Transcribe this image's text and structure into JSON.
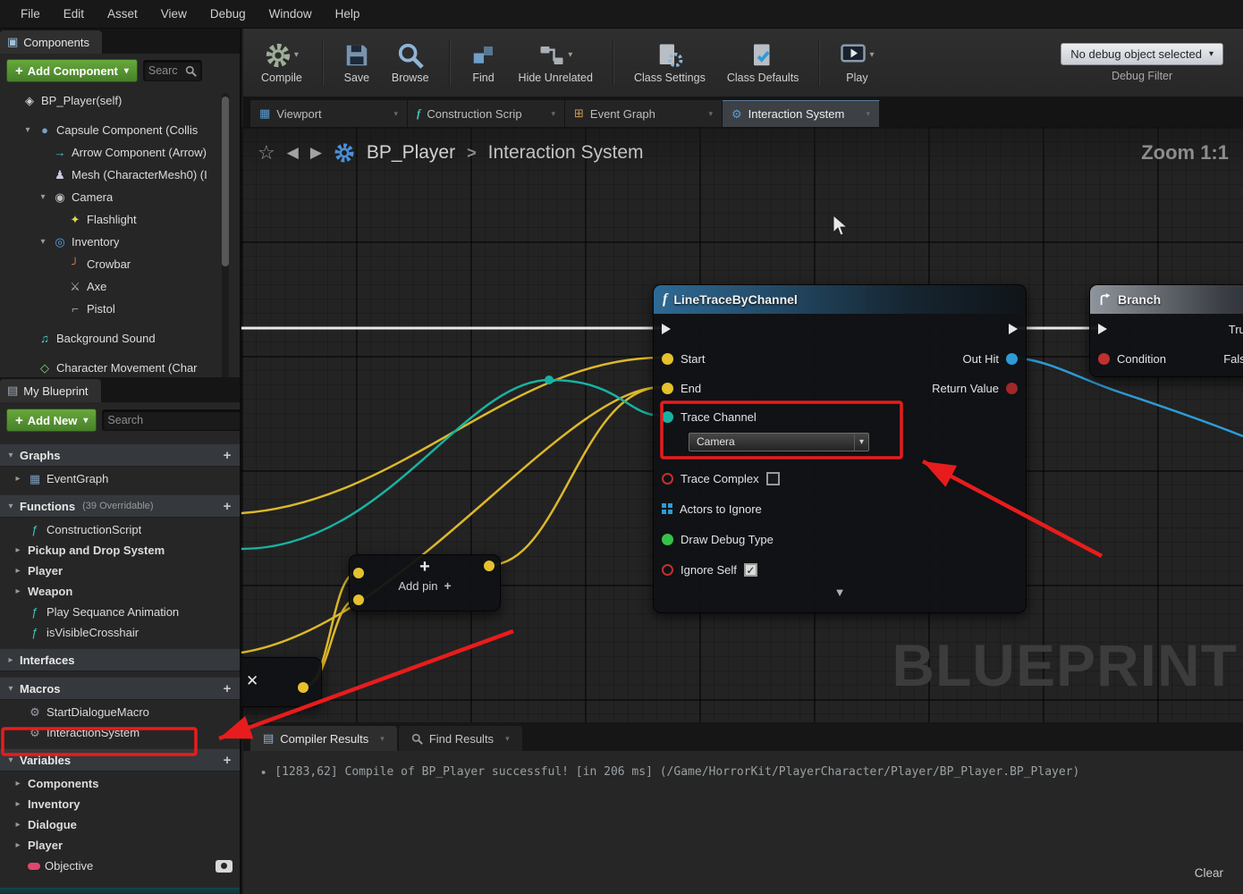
{
  "menu": {
    "items": [
      "File",
      "Edit",
      "Asset",
      "View",
      "Debug",
      "Window",
      "Help"
    ]
  },
  "colors": {
    "accent_green": "#5a9e2e",
    "annotation_red": "#e81c1c",
    "wire_yellow": "#dcb82a",
    "wire_teal": "#18b2a2",
    "wire_blue": "#2e9bd6",
    "exec_white": "#e8e8e8",
    "pin_red": "#c13030",
    "pin_green": "#35c24a"
  },
  "components_panel": {
    "title": "Components",
    "add_button_label": "Add Component",
    "search_placeholder": "Searc",
    "tree": [
      {
        "label": "BP_Player(self)",
        "depth": 0,
        "icon": "actor-icon",
        "expander": "",
        "gap_after": true
      },
      {
        "label": "Capsule Component (Collis",
        "depth": 1,
        "icon": "capsule-icon",
        "expander": "open"
      },
      {
        "label": "Arrow Component (Arrow)",
        "depth": 2,
        "icon": "arrow-icon",
        "expander": ""
      },
      {
        "label": "Mesh (CharacterMesh0) (I",
        "depth": 2,
        "icon": "mesh-icon",
        "expander": ""
      },
      {
        "label": "Camera",
        "depth": 2,
        "icon": "camera-icon",
        "expander": "open"
      },
      {
        "label": "Flashlight",
        "depth": 3,
        "icon": "flashlight-icon",
        "expander": ""
      },
      {
        "label": "Inventory",
        "depth": 2,
        "icon": "inventory-icon",
        "expander": "open"
      },
      {
        "label": "Crowbar",
        "depth": 3,
        "icon": "crowbar-icon",
        "expander": ""
      },
      {
        "label": "Axe",
        "depth": 3,
        "icon": "axe-icon",
        "expander": ""
      },
      {
        "label": "Pistol",
        "depth": 3,
        "icon": "pistol-icon",
        "expander": "",
        "gap_after": true
      },
      {
        "label": "Background Sound",
        "depth": 1,
        "icon": "sound-icon",
        "expander": "",
        "gap_after": true
      },
      {
        "label": "Character Movement (Char",
        "depth": 1,
        "icon": "movement-icon",
        "expander": ""
      }
    ]
  },
  "toolbar": {
    "compile_label": "Compile",
    "save_label": "Save",
    "browse_label": "Browse",
    "find_label": "Find",
    "hide_unrelated_label": "Hide Unrelated",
    "class_settings_label": "Class Settings",
    "class_defaults_label": "Class Defaults",
    "play_label": "Play",
    "debug_object_label": "No debug object selected",
    "debug_filter_label": "Debug Filter"
  },
  "doc_tabs": [
    {
      "label": "Viewport",
      "icon": "viewport-icon",
      "active": false
    },
    {
      "label": "Construction Scrip",
      "icon": "construction-script-icon",
      "active": false
    },
    {
      "label": "Event Graph",
      "icon": "event-graph-icon",
      "active": false
    },
    {
      "label": "Interaction System",
      "icon": "interaction-system-icon",
      "active": true
    }
  ],
  "breadcrumb": {
    "asset": "BP_Player",
    "page": "Interaction System",
    "zoom_label": "Zoom 1:1"
  },
  "graph": {
    "watermark": "BLUEPRINT",
    "linetrace": {
      "title": "LineTraceByChannel",
      "start": "Start",
      "end": "End",
      "out_hit": "Out Hit",
      "return_value": "Return Value",
      "trace_channel": "Trace Channel",
      "trace_channel_value": "Camera",
      "trace_complex": "Trace Complex",
      "actors_to_ignore": "Actors to Ignore",
      "draw_debug_type": "Draw Debug Type",
      "ignore_self": "Ignore Self"
    },
    "branch": {
      "title": "Branch",
      "true_label": "True",
      "false_label": "False",
      "condition_label": "Condition"
    },
    "addpin": {
      "label": "Add pin"
    }
  },
  "my_blueprint": {
    "title": "My Blueprint",
    "add_new_label": "Add New",
    "search_placeholder": "Search",
    "sections": [
      {
        "title": "Graphs",
        "plus": true,
        "expander": "open",
        "items": [
          {
            "label": "EventGraph",
            "icon": "graph-icon",
            "expander": "closed"
          }
        ]
      },
      {
        "title": "Functions",
        "suffix": "(39 Overridable)",
        "plus": true,
        "expander": "open",
        "items": [
          {
            "label": "ConstructionScript",
            "icon": "function-icon"
          },
          {
            "label": "Pickup and Drop System",
            "expander": "closed",
            "bold": true
          },
          {
            "label": "Player",
            "expander": "closed",
            "bold": true
          },
          {
            "label": "Weapon",
            "expander": "closed",
            "bold": true
          },
          {
            "label": "Play Sequance Animation",
            "icon": "function-icon"
          },
          {
            "label": "isVisibleCrosshair",
            "icon": "function-icon"
          }
        ]
      },
      {
        "title": "Interfaces",
        "plus": false,
        "expander": "closed",
        "items": []
      },
      {
        "title": "Macros",
        "plus": true,
        "expander": "open",
        "items": [
          {
            "label": "StartDialogueMacro",
            "icon": "macro-icon"
          },
          {
            "label": "InteractionSystem",
            "icon": "macro-icon",
            "highlight": true
          }
        ]
      },
      {
        "title": "Variables",
        "plus": true,
        "expander": "open",
        "items": [
          {
            "label": "Components",
            "expander": "closed",
            "bold": true
          },
          {
            "label": "Inventory",
            "expander": "closed",
            "bold": true
          },
          {
            "label": "Dialogue",
            "expander": "closed",
            "bold": true
          },
          {
            "label": "Player",
            "expander": "closed",
            "bold": true
          },
          {
            "label": "Objective",
            "icon": "variable-icon",
            "toggle": true
          }
        ]
      }
    ]
  },
  "bottom_panel": {
    "tabs": [
      {
        "label": "Compiler Results",
        "icon": "compiler-results-icon",
        "active": true
      },
      {
        "label": "Find Results",
        "icon": "find-results-icon",
        "active": false
      }
    ],
    "log_line": "[1283,62] Compile of BP_Player successful! [in 206 ms] (/Game/HorrorKit/PlayerCharacter/Player/BP_Player.BP_Player)",
    "clear_label": "Clear"
  }
}
